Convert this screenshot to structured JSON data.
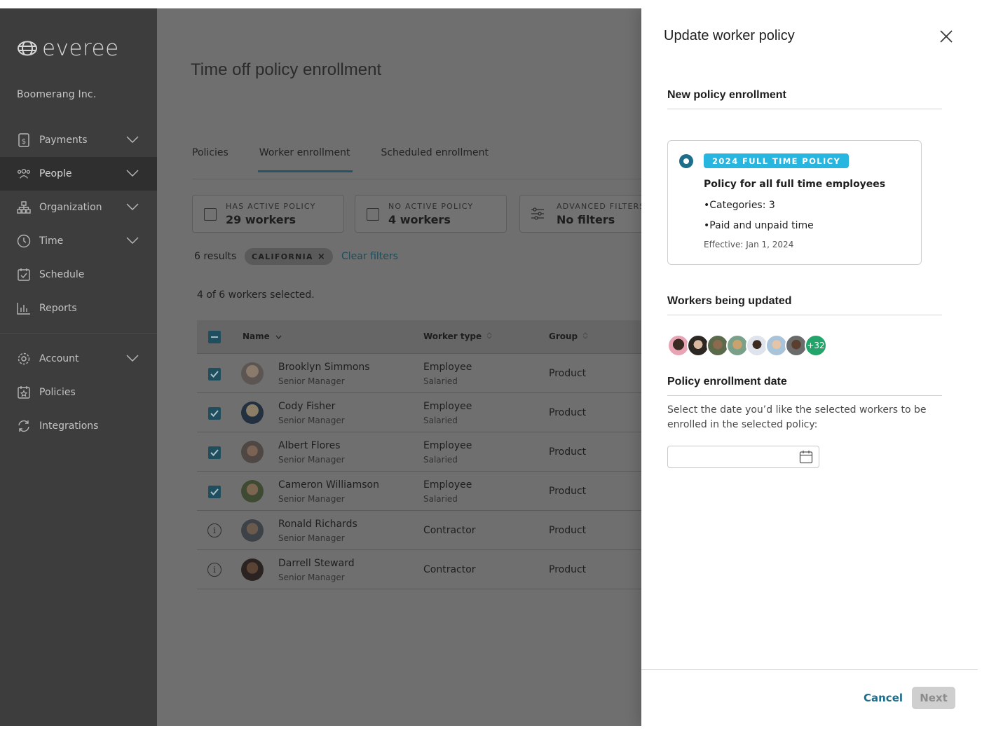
{
  "brand": {
    "logo_text": "everee",
    "company": "Boomerang Inc."
  },
  "sidebar": {
    "items": [
      {
        "label": "Payments",
        "icon": "payments-icon"
      },
      {
        "label": "People",
        "icon": "people-icon"
      },
      {
        "label": "Organization",
        "icon": "organization-icon"
      },
      {
        "label": "Time",
        "icon": "clock-icon"
      },
      {
        "label": "Schedule",
        "icon": "calendar-check-icon"
      },
      {
        "label": "Reports",
        "icon": "bar-chart-icon"
      },
      {
        "label": "Account",
        "icon": "gear-icon"
      },
      {
        "label": "Policies",
        "icon": "policy-calendar-icon"
      },
      {
        "label": "Integrations",
        "icon": "refresh-icon"
      }
    ]
  },
  "main": {
    "title": "Time off policy enrollment",
    "tabs": [
      "Policies",
      "Worker enrollment",
      "Scheduled enrollment"
    ],
    "filters": [
      {
        "label": "HAS ACTIVE POLICY",
        "value": "29 workers"
      },
      {
        "label": "NO ACTIVE POLICY",
        "value": "4 workers"
      },
      {
        "label": "ADVANCED FILTERS",
        "value": "No filters"
      }
    ],
    "results": "6 results",
    "chip": "CALIFORNIA",
    "chip_remove": "×",
    "clear_filters": "Clear filters",
    "selected_text": "4 of 6 workers selected.",
    "table": {
      "headers": [
        "Name",
        "Worker type",
        "Group"
      ],
      "rows": [
        {
          "name": "Brooklyn Simmons",
          "title": "Senior Manager",
          "type": "Employee",
          "subtype": "Salaried",
          "group": "Product",
          "checked": true
        },
        {
          "name": "Cody Fisher",
          "title": "Senior Manager",
          "type": "Employee",
          "subtype": "Salaried",
          "group": "Product",
          "checked": true
        },
        {
          "name": "Albert Flores",
          "title": "Senior Manager",
          "type": "Employee",
          "subtype": "Salaried",
          "group": "Product",
          "checked": true
        },
        {
          "name": "Cameron Williamson",
          "title": "Senior Manager",
          "type": "Employee",
          "subtype": "Salaried",
          "group": "Product",
          "checked": true
        },
        {
          "name": "Ronald Richards",
          "title": "Senior Manager",
          "type": "Contractor",
          "subtype": "",
          "group": "Product",
          "checked": false
        },
        {
          "name": "Darrell Steward",
          "title": "Senior Manager",
          "type": "Contractor",
          "subtype": "",
          "group": "Product",
          "checked": false
        }
      ]
    }
  },
  "panel": {
    "title": "Update worker policy",
    "section_new_policy": "New policy enrollment",
    "policy": {
      "badge": "2024 FULL TIME POLICY",
      "name": "Policy for all full time employees",
      "line1": "•Categories: 3",
      "line2": "•Paid and unpaid time",
      "effective": "Effective: Jan 1, 2024"
    },
    "section_workers": "Workers being updated",
    "more_workers": "+32",
    "section_date": "Policy enrollment date",
    "date_description": "Select the date you’d like the selected workers to be enrolled in the selected policy:",
    "date_value": "",
    "cancel": "Cancel",
    "next": "Next"
  },
  "colors": {
    "accent": "#1d6e8a",
    "badge": "#26b6e0",
    "more_badge": "#22a46a",
    "sidebar": "#3d3d3d"
  }
}
